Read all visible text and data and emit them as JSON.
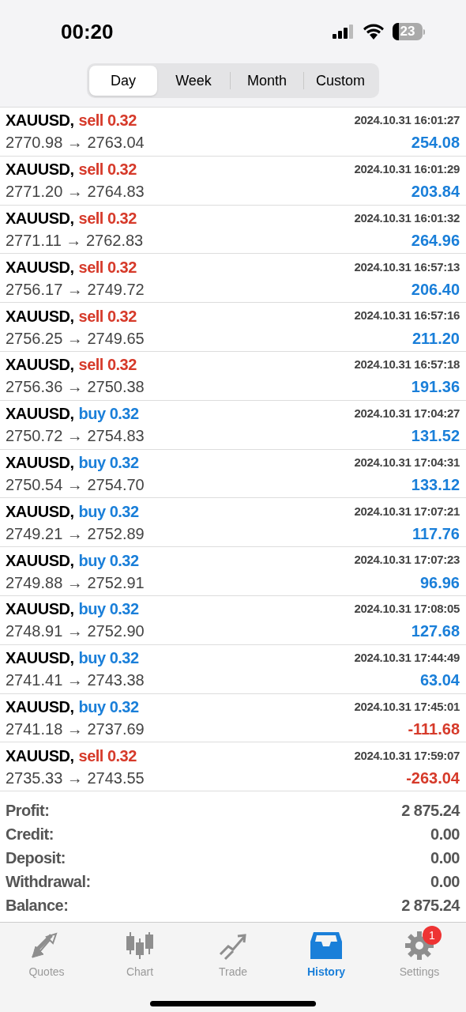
{
  "status_bar": {
    "time": "00:20",
    "battery": "23"
  },
  "periods": [
    {
      "label": "Day",
      "selected": true
    },
    {
      "label": "Week",
      "selected": false
    },
    {
      "label": "Month",
      "selected": false
    },
    {
      "label": "Custom",
      "selected": false
    }
  ],
  "deals": [
    {
      "symbol": "XAUUSD,",
      "kind": "sell",
      "order": "sell 0.32",
      "time": "2024.10.31 16:01:27",
      "prices": "2770.98 → 2763.04",
      "profit": "254.08",
      "loss": false
    },
    {
      "symbol": "XAUUSD,",
      "kind": "sell",
      "order": "sell 0.32",
      "time": "2024.10.31 16:01:29",
      "prices": "2771.20 → 2764.83",
      "profit": "203.84",
      "loss": false
    },
    {
      "symbol": "XAUUSD,",
      "kind": "sell",
      "order": "sell 0.32",
      "time": "2024.10.31 16:01:32",
      "prices": "2771.11 → 2762.83",
      "profit": "264.96",
      "loss": false
    },
    {
      "symbol": "XAUUSD,",
      "kind": "sell",
      "order": "sell 0.32",
      "time": "2024.10.31 16:57:13",
      "prices": "2756.17 → 2749.72",
      "profit": "206.40",
      "loss": false
    },
    {
      "symbol": "XAUUSD,",
      "kind": "sell",
      "order": "sell 0.32",
      "time": "2024.10.31 16:57:16",
      "prices": "2756.25 → 2749.65",
      "profit": "211.20",
      "loss": false
    },
    {
      "symbol": "XAUUSD,",
      "kind": "sell",
      "order": "sell 0.32",
      "time": "2024.10.31 16:57:18",
      "prices": "2756.36 → 2750.38",
      "profit": "191.36",
      "loss": false
    },
    {
      "symbol": "XAUUSD,",
      "kind": "buy",
      "order": "buy 0.32",
      "time": "2024.10.31 17:04:27",
      "prices": "2750.72 → 2754.83",
      "profit": "131.52",
      "loss": false
    },
    {
      "symbol": "XAUUSD,",
      "kind": "buy",
      "order": "buy 0.32",
      "time": "2024.10.31 17:04:31",
      "prices": "2750.54 → 2754.70",
      "profit": "133.12",
      "loss": false
    },
    {
      "symbol": "XAUUSD,",
      "kind": "buy",
      "order": "buy 0.32",
      "time": "2024.10.31 17:07:21",
      "prices": "2749.21 → 2752.89",
      "profit": "117.76",
      "loss": false
    },
    {
      "symbol": "XAUUSD,",
      "kind": "buy",
      "order": "buy 0.32",
      "time": "2024.10.31 17:07:23",
      "prices": "2749.88 → 2752.91",
      "profit": "96.96",
      "loss": false
    },
    {
      "symbol": "XAUUSD,",
      "kind": "buy",
      "order": "buy 0.32",
      "time": "2024.10.31 17:08:05",
      "prices": "2748.91 → 2752.90",
      "profit": "127.68",
      "loss": false
    },
    {
      "symbol": "XAUUSD,",
      "kind": "buy",
      "order": "buy 0.32",
      "time": "2024.10.31 17:44:49",
      "prices": "2741.41 → 2743.38",
      "profit": "63.04",
      "loss": false
    },
    {
      "symbol": "XAUUSD,",
      "kind": "buy",
      "order": "buy 0.32",
      "time": "2024.10.31 17:45:01",
      "prices": "2741.18 → 2737.69",
      "profit": "-111.68",
      "loss": true
    },
    {
      "symbol": "XAUUSD,",
      "kind": "sell",
      "order": "sell 0.32",
      "time": "2024.10.31 17:59:07",
      "prices": "2735.33 → 2743.55",
      "profit": "-263.04",
      "loss": true
    }
  ],
  "summary": [
    {
      "label": "Profit:",
      "value": "2 875.24"
    },
    {
      "label": "Credit:",
      "value": "0.00"
    },
    {
      "label": "Deposit:",
      "value": "0.00"
    },
    {
      "label": "Withdrawal:",
      "value": "0.00"
    },
    {
      "label": "Balance:",
      "value": "2 875.24"
    }
  ],
  "tab_bar": [
    {
      "kind": "quotes",
      "label": "Quotes",
      "selected": false
    },
    {
      "kind": "chart",
      "label": "Chart",
      "selected": false
    },
    {
      "kind": "trade",
      "label": "Trade",
      "selected": false
    },
    {
      "kind": "history",
      "label": "History",
      "selected": true
    },
    {
      "kind": "settings",
      "label": "Settings",
      "selected": false,
      "badge": "1"
    }
  ]
}
